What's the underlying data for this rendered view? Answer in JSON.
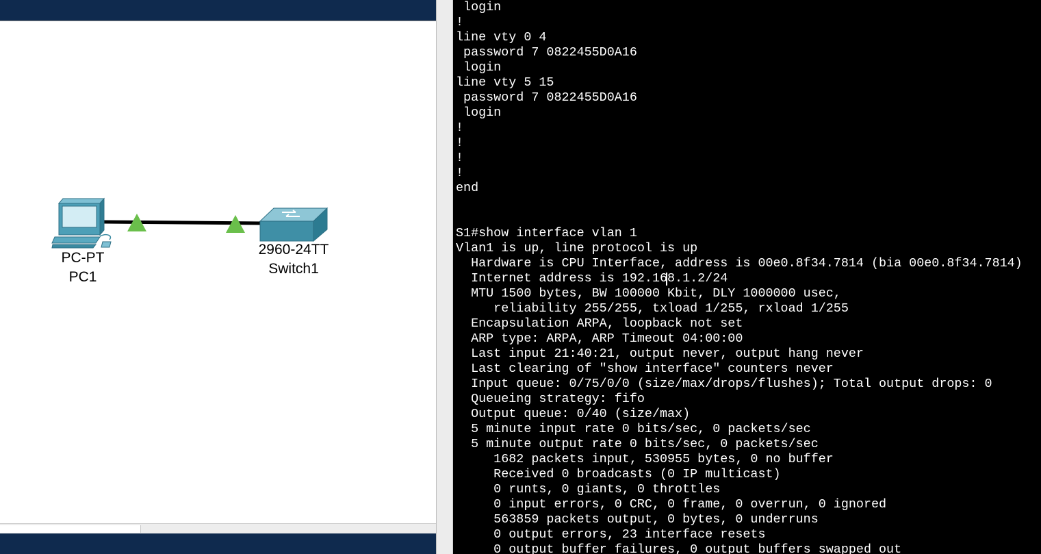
{
  "topology": {
    "devices": [
      {
        "model": "PC-PT",
        "name": "PC1"
      },
      {
        "model": "2960-24TT",
        "name": "Switch1"
      }
    ],
    "link_status_color": "#6abf4b"
  },
  "terminal": {
    "lines": [
      " login",
      "!",
      "line vty 0 4",
      " password 7 0822455D0A16",
      " login",
      "line vty 5 15",
      " password 7 0822455D0A16",
      " login",
      "!",
      "!",
      "!",
      "!",
      "end",
      "",
      "",
      "S1#show interface vlan 1",
      "Vlan1 is up, line protocol is up",
      "  Hardware is CPU Interface, address is 00e0.8f34.7814 (bia 00e0.8f34.7814)",
      "  Internet address is 192.168.1.2/24",
      "  MTU 1500 bytes, BW 100000 Kbit, DLY 1000000 usec,",
      "     reliability 255/255, txload 1/255, rxload 1/255",
      "  Encapsulation ARPA, loopback not set",
      "  ARP type: ARPA, ARP Timeout 04:00:00",
      "  Last input 21:40:21, output never, output hang never",
      "  Last clearing of \"show interface\" counters never",
      "  Input queue: 0/75/0/0 (size/max/drops/flushes); Total output drops: 0",
      "  Queueing strategy: fifo",
      "  Output queue: 0/40 (size/max)",
      "  5 minute input rate 0 bits/sec, 0 packets/sec",
      "  5 minute output rate 0 bits/sec, 0 packets/sec",
      "     1682 packets input, 530955 bytes, 0 no buffer",
      "     Received 0 broadcasts (0 IP multicast)",
      "     0 runts, 0 giants, 0 throttles",
      "     0 input errors, 0 CRC, 0 frame, 0 overrun, 0 ignored",
      "     563859 packets output, 0 bytes, 0 underruns",
      "     0 output errors, 23 interface resets",
      "     0 output buffer failures, 0 output buffers swapped out"
    ]
  },
  "colors": {
    "title_bar": "#0f2a4e",
    "terminal_bg": "#000000",
    "terminal_fg": "#ffffff",
    "device_blue": "#3f8fa6"
  },
  "icons": [
    "pc-icon",
    "switch-icon",
    "link-up-icon"
  ]
}
